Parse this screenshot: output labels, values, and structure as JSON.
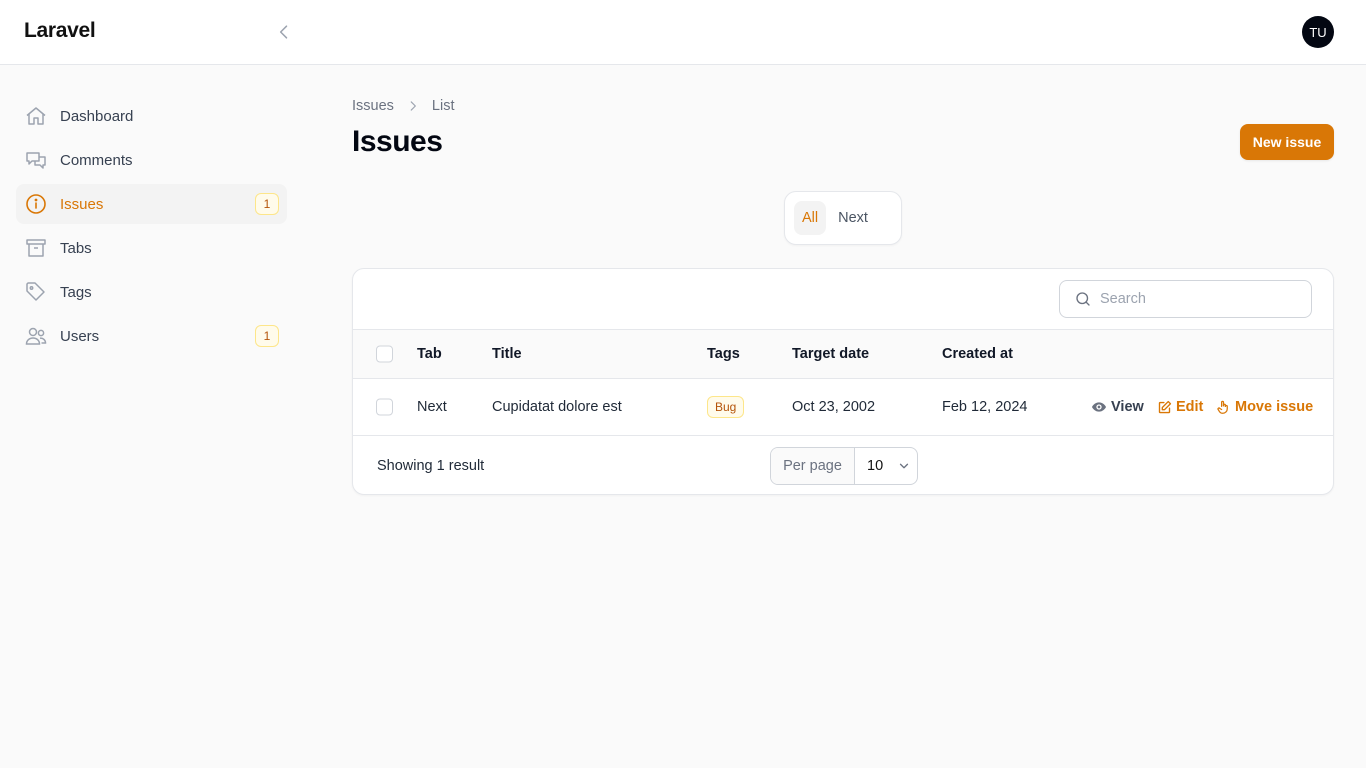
{
  "app": {
    "brand": "Laravel",
    "avatar_initials": "TU"
  },
  "sidebar": {
    "items": [
      {
        "label": "Dashboard",
        "icon": "home-icon"
      },
      {
        "label": "Comments",
        "icon": "chat-bubbles-icon"
      },
      {
        "label": "Issues",
        "icon": "info-circle-icon",
        "badge": "1",
        "active": true
      },
      {
        "label": "Tabs",
        "icon": "archive-box-icon"
      },
      {
        "label": "Tags",
        "icon": "tag-icon"
      },
      {
        "label": "Users",
        "icon": "users-icon",
        "badge": "1"
      }
    ]
  },
  "breadcrumb": [
    "Issues",
    "List"
  ],
  "page": {
    "title": "Issues",
    "new_button": "New issue"
  },
  "tabs": [
    {
      "label": "All",
      "active": true
    },
    {
      "label": "Next",
      "active": false
    }
  ],
  "table": {
    "search_placeholder": "Search",
    "columns": [
      "Tab",
      "Title",
      "Tags",
      "Target date",
      "Created at"
    ],
    "rows": [
      {
        "tab": "Next",
        "title": "Cupidatat dolore est",
        "tags": [
          "Bug"
        ],
        "target_date": "Oct 23, 2002",
        "created_at": "Feb 12, 2024",
        "actions": [
          "View",
          "Edit",
          "Move issue"
        ]
      }
    ],
    "summary": "Showing 1 result",
    "per_page_label": "Per page",
    "per_page_value": "10"
  },
  "colors": {
    "accent": "#d97706",
    "accent_bg": "#fffbeb",
    "avatar_bg": "#030712"
  }
}
